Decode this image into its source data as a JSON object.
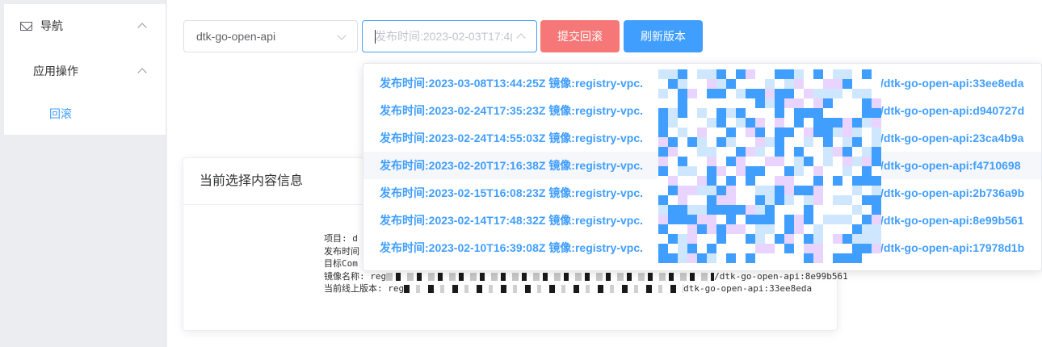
{
  "sidebar": {
    "nav_label": "导航",
    "group_label": "应用操作",
    "active_item": "回滚"
  },
  "toolbar": {
    "app_select_value": "dtk-go-open-api",
    "version_placeholder": "发布时间:2023-02-03T17:4(",
    "rollback_label": "提交回滚",
    "refresh_label": "刷新版本"
  },
  "card": {
    "title": "当前选择内容信息",
    "lines": [
      "项目: d",
      "发布时间",
      "目标Com",
      "镜像名称: reg",
      "当前线上版本: reg"
    ],
    "line4_tail": "/dtk-go-open-api:8e99b561",
    "line5_tail": "dtk-go-open-api:33ee8eda"
  },
  "dropdown": {
    "options": [
      {
        "time": "发布时间:2023-03-08T13:44:25Z",
        "image": "镜像:registry-vpc.",
        "tail": "/dtk-go-open-api:33ee8eda"
      },
      {
        "time": "发布时间:2023-02-24T17:35:23Z",
        "image": "镜像:registry-vpc.",
        "tail": "/dtk-go-open-api:d940727d"
      },
      {
        "time": "发布时间:2023-02-24T14:55:03Z",
        "image": "镜像:registry-vpc.",
        "tail": "/dtk-go-open-api:23ca4b9a"
      },
      {
        "time": "发布时间:2023-02-20T17:16:38Z",
        "image": "镜像:registry-vpc.",
        "tail": "/dtk-go-open-api:f4710698"
      },
      {
        "time": "发布时间:2023-02-15T16:08:23Z",
        "image": "镜像:registry-vpc.",
        "tail": "/dtk-go-open-api:2b736a9b"
      },
      {
        "time": "发布时间:2023-02-14T17:48:32Z",
        "image": "镜像:registry-vpc.",
        "tail": "/dtk-go-open-api:8e99b561"
      },
      {
        "time": "发布时间:2023-02-10T16:39:08Z",
        "image": "镜像:registry-vpc.",
        "tail": "/dtk-go-open-api:17978d1b"
      }
    ]
  },
  "colors": {
    "accent": "#409eff",
    "danger": "#f56c6c",
    "mosaic_pink": "#e8d4ff",
    "mosaic_dark": "#1a1a1a"
  }
}
